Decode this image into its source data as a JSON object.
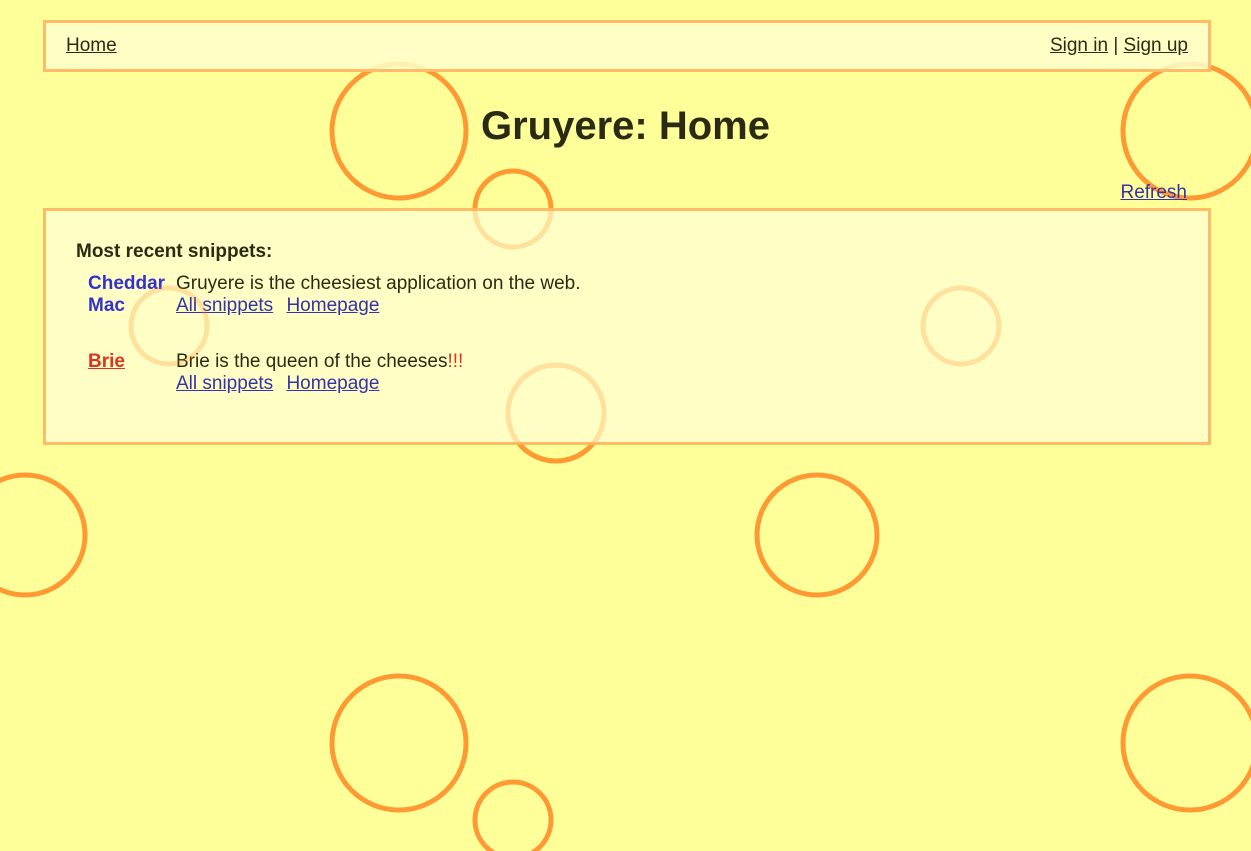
{
  "menu": {
    "home": "Home",
    "sign_in": "Sign in",
    "separator": "|",
    "sign_up": "Sign up"
  },
  "page": {
    "title": "Gruyere: Home",
    "refresh": "Refresh"
  },
  "snippets": {
    "heading": "Most recent snippets:",
    "items": [
      {
        "user": "Cheddar Mac",
        "text": "Gruyere is the cheesiest application on the web.",
        "emphasis": "",
        "all_snippets": "All snippets",
        "homepage": "Homepage"
      },
      {
        "user": "Brie",
        "text": "Brie is the queen of the cheeses",
        "emphasis": "!!!",
        "all_snippets": "All snippets",
        "homepage": "Homepage"
      }
    ]
  },
  "colors": {
    "background": "#ffff99",
    "panel": "#ffffcc",
    "border": "#ffbb66",
    "hole": "#ff9933",
    "link": "#3333aa",
    "user": "#3333cc",
    "accent": "#dd3322"
  }
}
